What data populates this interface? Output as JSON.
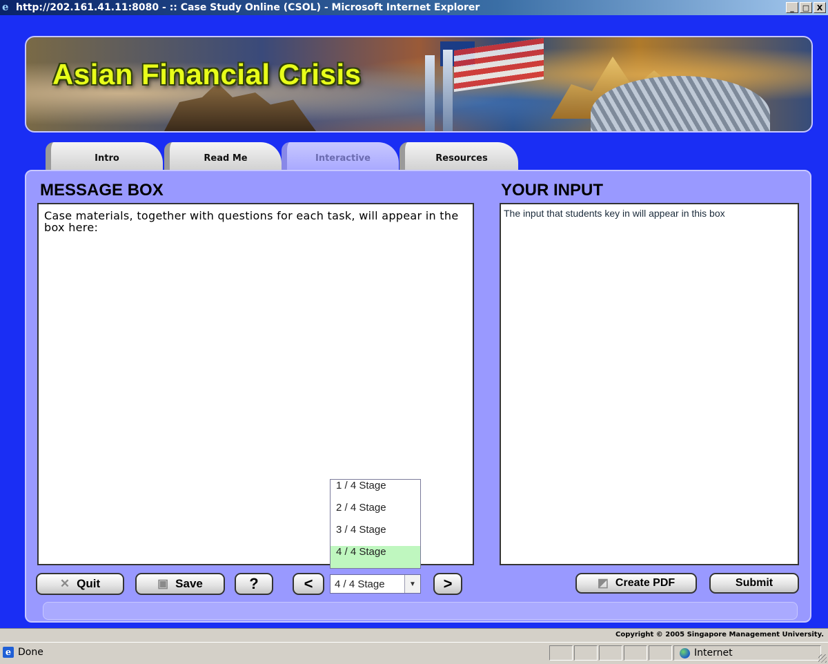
{
  "window": {
    "title": "http://202.161.41.11:8080 - :: Case Study Online (CSOL) - Microsoft Internet Explorer",
    "buttons": [
      "_",
      "□",
      "X"
    ]
  },
  "banner": {
    "title": "Asian Financial Crisis"
  },
  "tabs": [
    {
      "label": "Intro",
      "active": false
    },
    {
      "label": "Read Me",
      "active": false
    },
    {
      "label": "Interactive",
      "active": true
    },
    {
      "label": "Resources",
      "active": false
    }
  ],
  "message_box": {
    "heading": "MESSAGE BOX",
    "text": "Case materials, together with questions for each task, will appear in the box here:"
  },
  "your_input": {
    "heading": "YOUR INPUT",
    "text": "The input that students key in will appear in this box"
  },
  "toolbar": {
    "quit_label": "Quit",
    "save_label": "Save",
    "help_label": "?",
    "prev_label": "<",
    "next_label": ">",
    "create_pdf_label": "Create PDF",
    "submit_label": "Submit"
  },
  "stage": {
    "selected": "4 / 4 Stage",
    "options": [
      "1 / 4 Stage",
      "2 / 4 Stage",
      "3 / 4 Stage",
      "4 / 4 Stage"
    ]
  },
  "copyright": "Copyright © 2005 Singapore Management University.",
  "statusbar": {
    "status": "Done",
    "zone": "Internet"
  },
  "colors": {
    "app_bg": "#1a2ef4",
    "panel_bg": "#9999ff",
    "banner_title": "#e8ff1a",
    "selected_option": "#bff7bf"
  }
}
